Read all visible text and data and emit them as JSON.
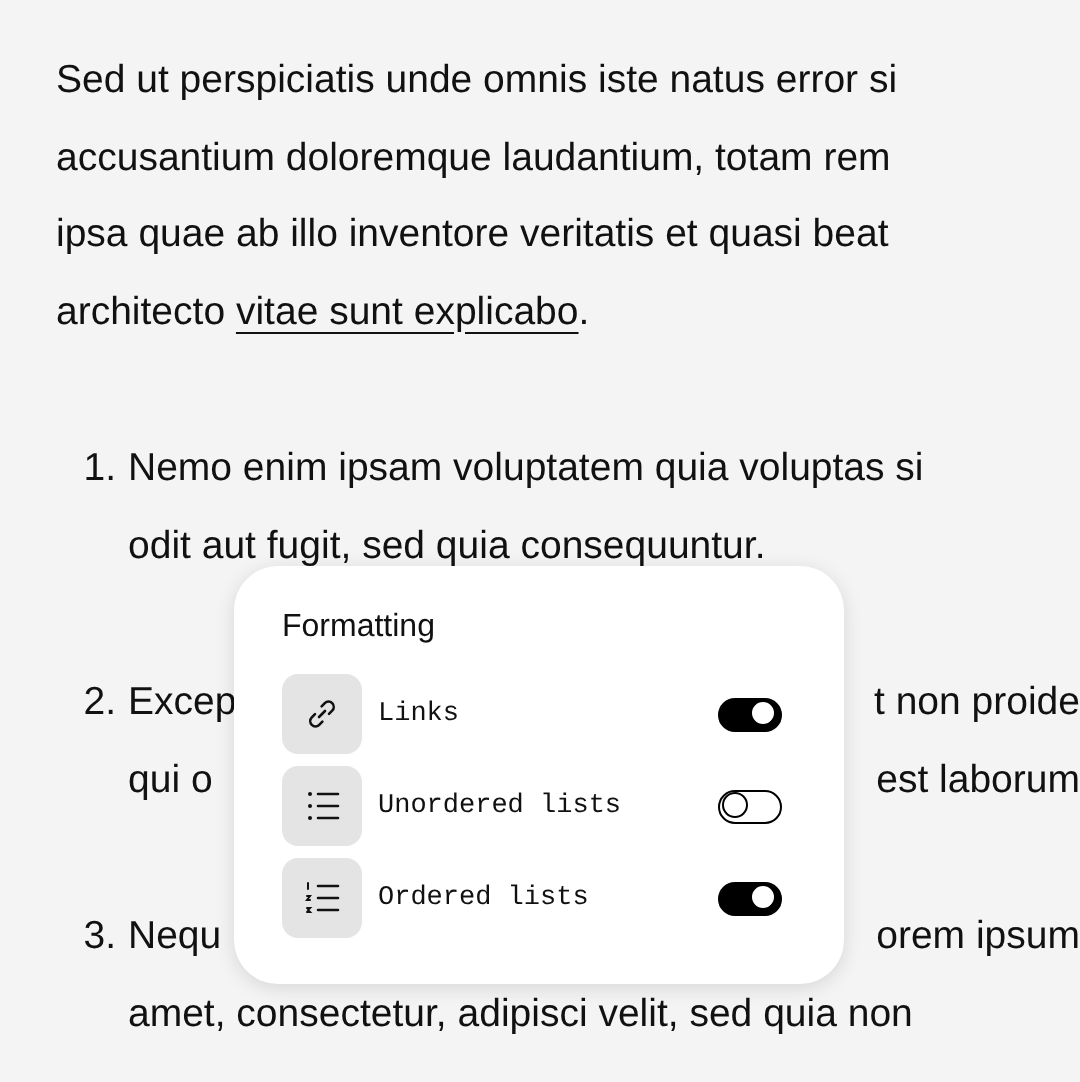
{
  "paragraph": {
    "lines": [
      "Sed ut perspiciatis unde omnis iste natus error si",
      "accusantium doloremque laudantium, totam rem",
      "ipsa quae ab illo inventore veritatis et quasi beat"
    ],
    "last_line": {
      "text": "architecto ",
      "link": "vitae sunt explicabo",
      "end": "."
    }
  },
  "list": [
    {
      "number": "1.",
      "lines": [
        [
          "Nemo enim ipsam voluptatem quia voluptas si"
        ],
        [
          "odit aut fugit, sed quia consequuntur."
        ]
      ]
    },
    {
      "number": "2.",
      "lines": [
        [
          "Excep",
          "t non proide"
        ],
        [
          "qui o",
          "est laborum"
        ]
      ]
    },
    {
      "number": "3.",
      "lines": [
        [
          "Nequ",
          "orem ipsum"
        ],
        [
          "amet, consectetur, adipisci velit, sed quia non"
        ]
      ]
    }
  ],
  "popup": {
    "title": "Formatting",
    "options": [
      {
        "kind": "link",
        "label": "Links",
        "on": true
      },
      {
        "kind": "bullets",
        "label": "Unordered lists",
        "on": false
      },
      {
        "kind": "numbers",
        "label": "Ordered lists",
        "on": true
      }
    ]
  }
}
